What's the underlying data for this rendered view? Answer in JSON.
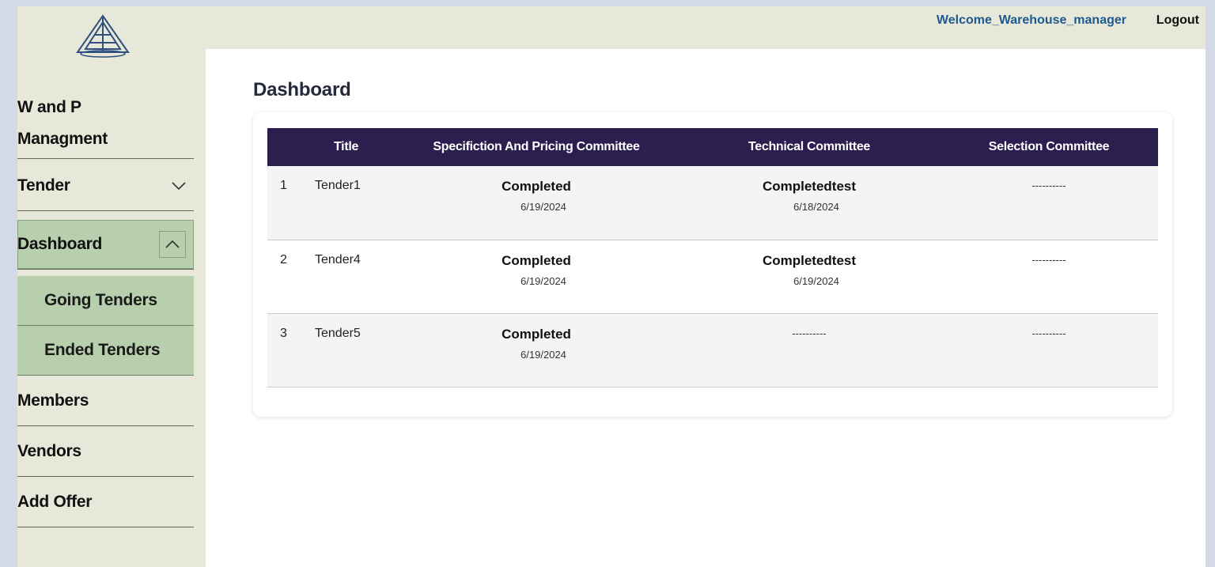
{
  "sidebar": {
    "logo_icon": "emblem-logo-icon",
    "brand_line1": "W and P",
    "brand_line2": "Managment",
    "items": [
      {
        "label": "Tender",
        "icon": "chevron-down-icon"
      },
      {
        "label": "Dashboard",
        "icon": "chevron-up-icon"
      },
      {
        "label": "Going Tenders"
      },
      {
        "label": "Ended Tenders"
      },
      {
        "label": "Members"
      },
      {
        "label": "Vendors"
      },
      {
        "label": "Add Offer"
      }
    ]
  },
  "header": {
    "welcome": "Welcome_Warehouse_manager",
    "logout": "Logout"
  },
  "main": {
    "title": "Dashboard",
    "table": {
      "columns": [
        "Title",
        "Specifiction And Pricing Committee",
        "Technical Committee",
        "Selection Committee"
      ],
      "rows": [
        {
          "num": "1",
          "title": "Tender1",
          "spec_status": "Completed",
          "spec_date": "6/19/2024",
          "tech_status": "Completedtest",
          "tech_date": "6/18/2024",
          "selection": "----------"
        },
        {
          "num": "2",
          "title": "Tender4",
          "spec_status": "Completed",
          "spec_date": "6/19/2024",
          "tech_status": "Completedtest",
          "tech_date": "6/19/2024",
          "selection": "----------"
        },
        {
          "num": "3",
          "title": "Tender5",
          "spec_status": "Completed",
          "spec_date": "6/19/2024",
          "tech_status": "----------",
          "tech_date": "",
          "selection": "----------"
        }
      ]
    }
  },
  "colors": {
    "sidebar_bg": "#e7e8d9",
    "active_bg": "#b8cfad",
    "table_header": "#2b1f4f",
    "welcome_text": "#1d5a8f"
  }
}
